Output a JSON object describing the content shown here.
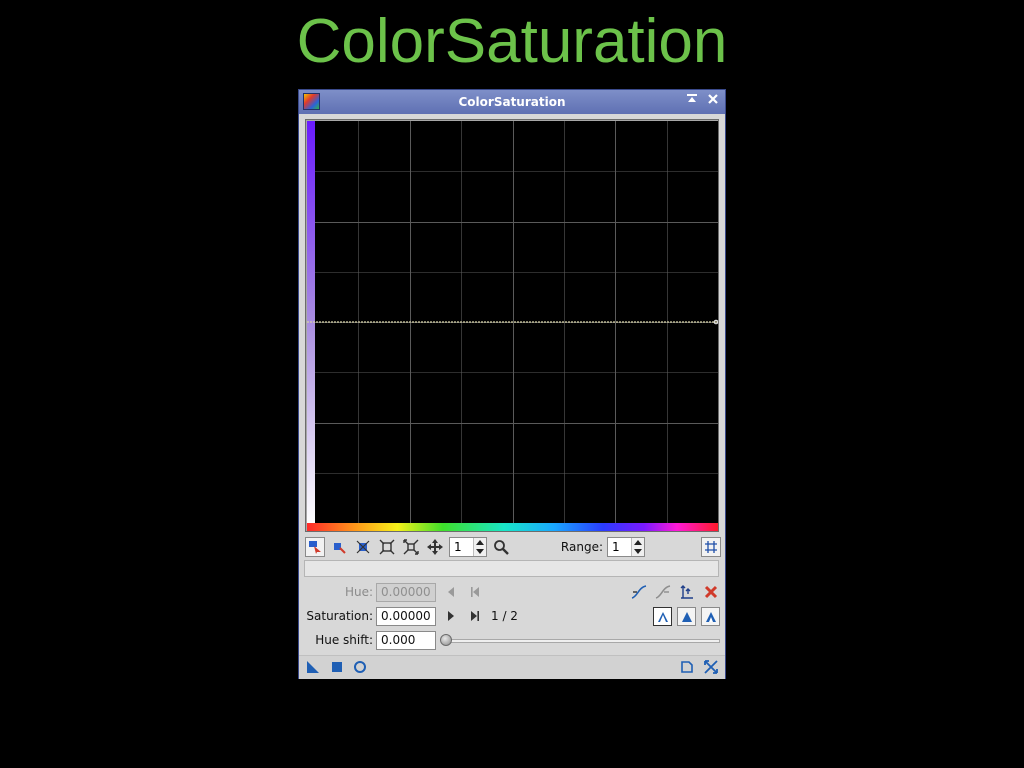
{
  "slide": {
    "title": "ColorSaturation"
  },
  "window": {
    "title": "ColorSaturation",
    "shade_icon": "shade-window-icon",
    "close_icon": "close-icon"
  },
  "graph": {
    "curve_value": 0.5,
    "grid_columns": 8,
    "grid_rows": 8,
    "curve_color": "#d8d2a8",
    "grid_color": "#5a5a5a"
  },
  "graph_toolbar": {
    "zoom_value": "1",
    "range_label": "Range:",
    "range_value": "1"
  },
  "controls": {
    "hue_label": "Hue:",
    "hue_value": "0.00000",
    "saturation_label": "Saturation:",
    "saturation_value": "0.00000",
    "point_counter": "1 / 2",
    "hue_shift_label": "Hue shift:",
    "hue_shift_value": "0.000"
  },
  "colors": {
    "title_green": "#6cc24a",
    "window_border": "#3a4a8c",
    "titlebar": "#6f80bf",
    "accent_blue": "#1f5fb4",
    "delete_red": "#d03a2a"
  }
}
